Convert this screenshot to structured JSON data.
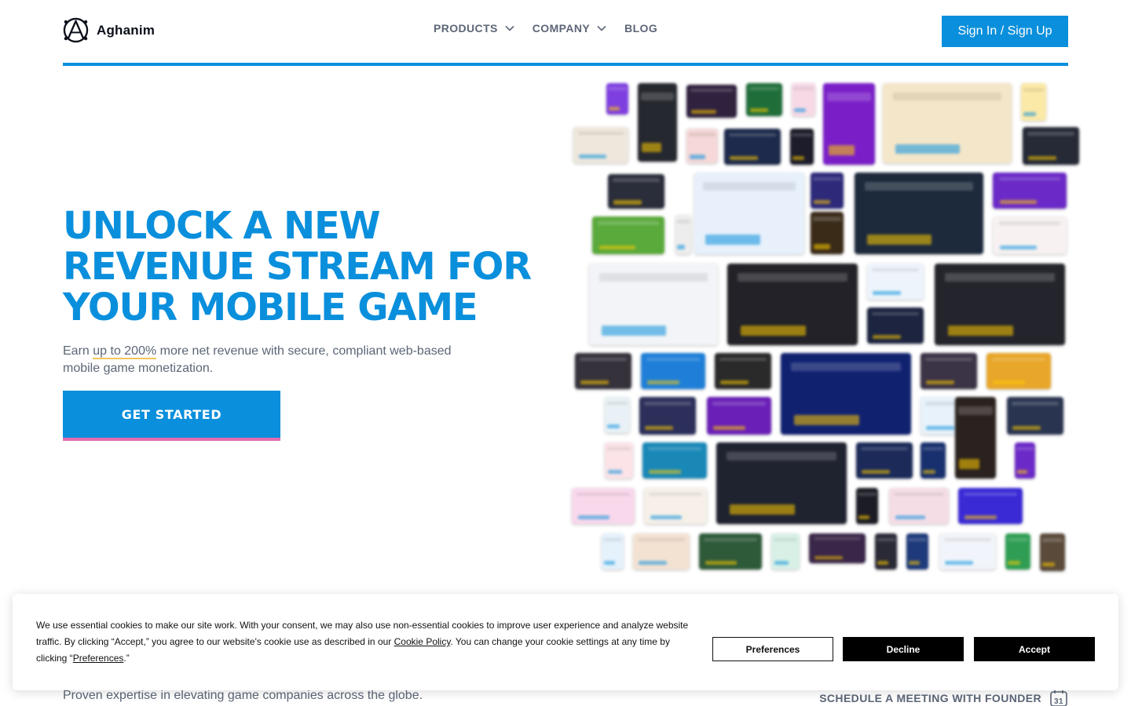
{
  "brand": {
    "name": "Aghanim",
    "primary": "#0a8fdc",
    "accent": "#e46bb0",
    "highlight": "#f0c55a"
  },
  "nav": {
    "items": [
      {
        "label": "PRODUCTS",
        "has_dropdown": true
      },
      {
        "label": "COMPANY",
        "has_dropdown": true
      },
      {
        "label": "BLOG",
        "has_dropdown": false
      }
    ],
    "signin_label": "Sign In / Sign Up"
  },
  "hero": {
    "title_lines": [
      "UNLOCK A NEW",
      "REVENUE STREAM FOR",
      "YOUR MOBILE GAME"
    ],
    "subtitle_before": "Earn ",
    "subtitle_highlight": "up to 200%",
    "subtitle_after": " more net revenue with secure, compliant web-based mobile game monetization.",
    "cta_label": "GET STARTED"
  },
  "collage": {
    "label": "web store screenshots collage"
  },
  "footer_strip": {
    "tagline": "Proven expertise in elevating game companies across the globe.",
    "meeting_label": "SCHEDULE A MEETING WITH FOUNDER",
    "calendar_day": "31"
  },
  "cookie": {
    "text_part1": "We use essential cookies to make our site work. With your consent, we may also use non-essential cookies to improve user experience and analyze website traffic. By clicking “Accept,” you agree to our website's cookie use as described in our ",
    "policy_link": "Cookie Policy",
    "text_part2": ". You can change your cookie settings at any time by clicking “",
    "preferences_link": "Preferences",
    "text_part3": ".”",
    "preferences_label": "Preferences",
    "decline_label": "Decline",
    "accept_label": "Accept"
  }
}
